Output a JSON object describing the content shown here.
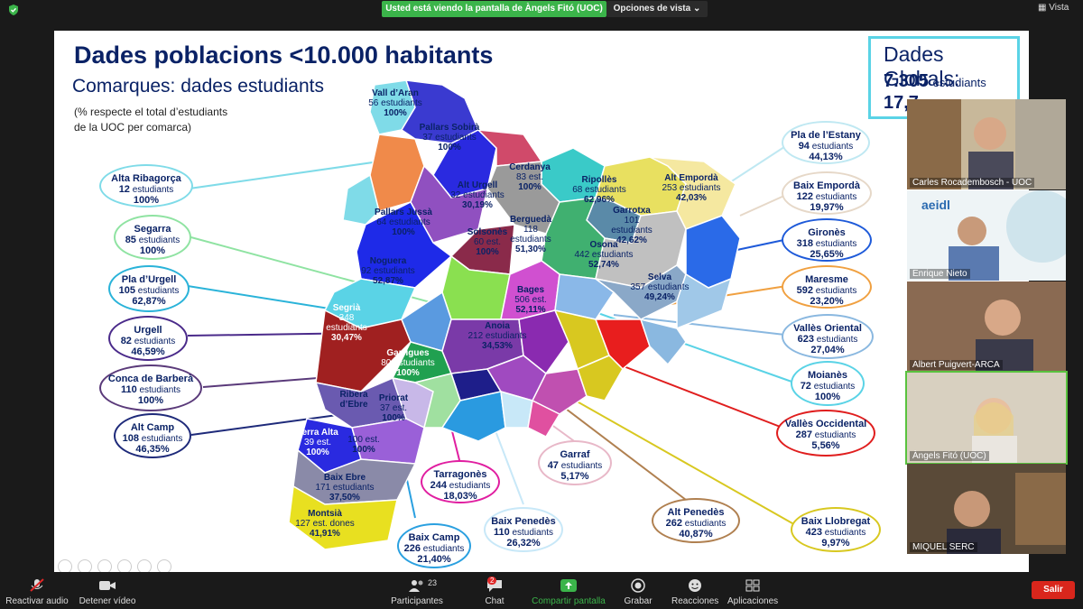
{
  "top_bar": {
    "share_banner": "Usted está viendo la pantalla de Àngels Fitó (UOC)",
    "view_options": "Opciones de vista",
    "view_options_icon": "chevron-down-icon",
    "view_button": "Vista",
    "security_icon": "shield-icon"
  },
  "slide": {
    "title": "Dades poblacions <10.000 habitants",
    "subtitle": "Comarques: dades estudiants",
    "note_line1": "(% respecte el total d’estudiants",
    "note_line2": "de la UOC per comarca)",
    "globals": {
      "title": "Dades Globals:",
      "students_value": "7.305",
      "students_unit": "estudiants",
      "second_value_partial": "17,7"
    },
    "callouts": [
      {
        "name": "Alta Ribagorça",
        "students": "12",
        "unit": "estudiants",
        "percent": "100%",
        "color": "#7fdbe8"
      },
      {
        "name": "Segarra",
        "students": "85",
        "unit": "estudiants",
        "percent": "100%",
        "color": "#8fe3a2"
      },
      {
        "name": "Pla d’Urgell",
        "students": "105",
        "unit": "estudiants",
        "percent": "62,87%",
        "color": "#2ab3d9"
      },
      {
        "name": "Urgell",
        "students": "82",
        "unit": "estudiants",
        "percent": "46,59%",
        "color": "#4a2a8a"
      },
      {
        "name": "Conca de Barberà",
        "students": "110",
        "unit": "estudiants",
        "percent": "100%",
        "color": "#5a3a7a"
      },
      {
        "name": "Alt Camp",
        "students": "108",
        "unit": "estudiants",
        "percent": "46,35%",
        "color": "#1e2a7a"
      },
      {
        "name": "Pla de l’Estany",
        "students": "94",
        "unit": "estudiants",
        "percent": "44,13%",
        "color": "#bfe8f2"
      },
      {
        "name": "Baix Empordà",
        "students": "122",
        "unit": "estudiants",
        "percent": "19,97%",
        "color": "#e6d8c8"
      },
      {
        "name": "Gironès",
        "students": "318",
        "unit": "estudiants",
        "percent": "25,65%",
        "color": "#1e5ad9"
      },
      {
        "name": "Maresme",
        "students": "592",
        "unit": "estudiants",
        "percent": "23,20%",
        "color": "#f0a040"
      },
      {
        "name": "Vallès Oriental",
        "students": "623",
        "unit": "estudiants",
        "percent": "27,04%",
        "color": "#8ab8e0"
      },
      {
        "name": "Moianès",
        "students": "72",
        "unit": "estudiants",
        "percent": "100%",
        "color": "#5ad3e6"
      },
      {
        "name": "Vallès Occidental",
        "students": "287",
        "unit": "estudiants",
        "percent": "5,56%",
        "color": "#e01e1e"
      },
      {
        "name": "Baix Llobregat",
        "students": "423",
        "unit": "estudiants",
        "percent": "9,97%",
        "color": "#d8c820"
      },
      {
        "name": "Alt Penedès",
        "students": "262",
        "unit": "estudiants",
        "percent": "40,87%",
        "color": "#b08050"
      },
      {
        "name": "Garraf",
        "students": "47",
        "unit": "estudiants",
        "percent": "5,17%",
        "color": "#e8b8c8"
      },
      {
        "name": "Baix Penedès",
        "students": "110",
        "unit": "estudiants",
        "percent": "26,32%",
        "color": "#c8e8f8"
      },
      {
        "name": "Tarragonès",
        "students": "244",
        "unit": "estudiants",
        "percent": "18,03%",
        "color": "#e01ea0"
      },
      {
        "name": "Baix Camp",
        "students": "226",
        "unit": "estudiants",
        "percent": "21,40%",
        "color": "#2aa0e0"
      }
    ],
    "map_labels": [
      {
        "name": "Vall d’Aran",
        "line2": "56 estudiants",
        "percent": "100%"
      },
      {
        "name": "Pallars Sobirà",
        "line2": "37 estudiants",
        "percent": "100%"
      },
      {
        "name": "Cerdanya",
        "line2": "83 est.",
        "percent": "100%"
      },
      {
        "name": "Alt Urgell",
        "line2": "32 estudiants",
        "percent": "30,19%"
      },
      {
        "name": "Ripollès",
        "line2": "68 estudiants",
        "percent": "62,96%"
      },
      {
        "name": "Alt Empordà",
        "line2": "253 estudiants",
        "percent": "42,03%"
      },
      {
        "name": "Pallars Jussà",
        "line2": "64 estudiants",
        "percent": "100%"
      },
      {
        "name": "Berguedà",
        "line2": "118 estudiants",
        "percent": "51,30%"
      },
      {
        "name": "Garrotxa",
        "line2": "101 estudiants",
        "percent": "42,62%"
      },
      {
        "name": "Solsonès",
        "line2": "60 est.",
        "percent": "100%"
      },
      {
        "name": "Osona",
        "line2": "442 estudiants",
        "percent": "52,74%"
      },
      {
        "name": "Noguera",
        "line2": "92 estudiants",
        "percent": "52,87%"
      },
      {
        "name": "Selva",
        "line2": "357 estudiants",
        "percent": "49,24%"
      },
      {
        "name": "Bages",
        "line2": "506 est.",
        "percent": "52,11%"
      },
      {
        "name": "Segrià",
        "line2": "348 estudiants",
        "percent": "30,47%"
      },
      {
        "name": "Anoia",
        "line2": "212 estudiants",
        "percent": "34,53%"
      },
      {
        "name": "Garrigues",
        "line2": "80 estudiants",
        "percent": "100%"
      },
      {
        "name": "Ribera d’Ebre",
        "line2": "",
        "percent": ""
      },
      {
        "name": "Priorat",
        "line2": "37 est.",
        "percent": "100%"
      },
      {
        "name": "Terra Alta",
        "line2": "39 est.",
        "percent": "100%"
      },
      {
        "name": "",
        "line2": "100 est.",
        "percent": "100%"
      },
      {
        "name": "Baix Ebre",
        "line2": "171 estudiants",
        "percent": "37,50%"
      },
      {
        "name": "Montsià",
        "line2": "127 est. dones",
        "percent": "41,91%"
      }
    ]
  },
  "participants": [
    {
      "name": "Carles Rocadembosch - UOC"
    },
    {
      "name": "Enrique Nieto",
      "logo_text": "aeidl"
    },
    {
      "name": "Albert Puigvert-ARCA"
    },
    {
      "name": "Àngels Fitó (UOC)"
    },
    {
      "name": "MIQUEL SERC"
    }
  ],
  "toolbar": {
    "mute": "Reactivar audio",
    "video": "Detener vídeo",
    "participants": "Participantes",
    "participants_count": "23",
    "chat": "Chat",
    "chat_badge": "2",
    "share": "Compartir pantalla",
    "record": "Grabar",
    "reactions": "Reacciones",
    "apps": "Aplicaciones",
    "leave": "Salir"
  },
  "colors": {
    "share_green": "#3bb44a",
    "title_navy": "#0a2266",
    "leave_red": "#d9261c",
    "active_speaker": "#59c23e"
  }
}
